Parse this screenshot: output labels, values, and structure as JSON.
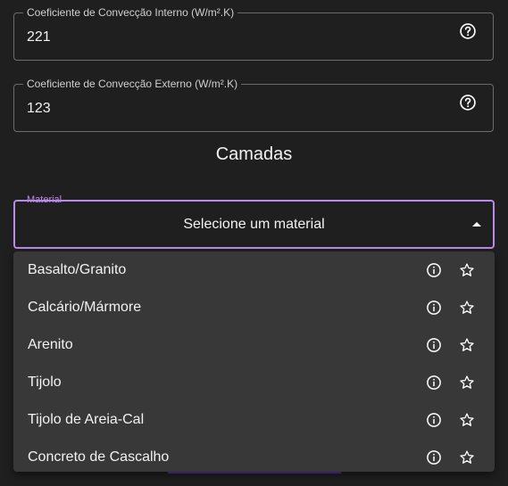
{
  "form": {
    "internal_coefficient": {
      "label": "Coeficiente de Convecção Interno (W/m².K)",
      "value": "221"
    },
    "external_coefficient": {
      "label": "Coeficiente de Convecção Externo (W/m².K)",
      "value": "123"
    },
    "section_title": "Camadas",
    "material_select": {
      "label": "Material",
      "selected": "Selecione um material",
      "accent_color": "#b98ae8"
    }
  },
  "menu": {
    "items": [
      {
        "label": "Basalto/Granito",
        "info_icon": "info-circle-icon",
        "star_icon": "star-outline-icon"
      },
      {
        "label": "Calcário/Mármore",
        "info_icon": "info-circle-icon",
        "star_icon": "star-outline-icon"
      },
      {
        "label": "Arenito",
        "info_icon": "info-circle-icon",
        "star_icon": "star-outline-icon"
      },
      {
        "label": "Tijolo",
        "info_icon": "info-circle-icon",
        "star_icon": "star-outline-icon"
      },
      {
        "label": "Tijolo de Areia-Cal",
        "info_icon": "info-circle-icon",
        "star_icon": "star-outline-icon"
      },
      {
        "label": "Concreto de Cascalho",
        "info_icon": "info-circle-icon",
        "star_icon": "star-outline-icon"
      }
    ]
  }
}
